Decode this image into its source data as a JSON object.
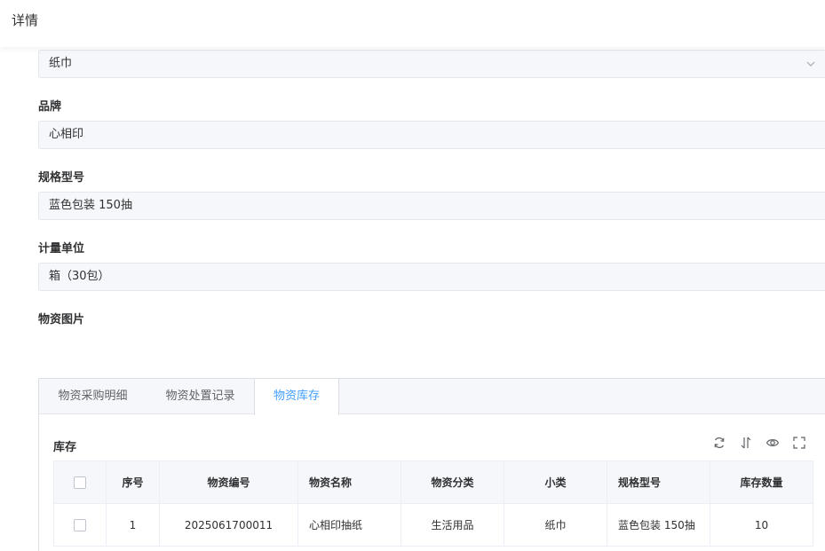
{
  "header": {
    "title": "详情"
  },
  "form": {
    "category_value": "纸巾",
    "brand_label": "品牌",
    "brand_value": "心相印",
    "spec_label": "规格型号",
    "spec_value": "蓝色包装 150抽",
    "unit_label": "计量单位",
    "unit_value": "箱（30包）",
    "image_label": "物资图片"
  },
  "tabs": [
    {
      "label": "物资采购明细",
      "active": false
    },
    {
      "label": "物资处置记录",
      "active": false
    },
    {
      "label": "物资库存",
      "active": true
    }
  ],
  "stock": {
    "title": "库存",
    "toolbar_icons": [
      "refresh-icon",
      "column-height-icon",
      "eye-icon",
      "fullscreen-icon"
    ],
    "columns": [
      "序号",
      "物资编号",
      "物资名称",
      "物资分类",
      "小类",
      "规格型号",
      "库存数量"
    ],
    "rows": [
      {
        "index": "1",
        "code": "2025061700011",
        "name": "心相印抽纸",
        "category": "生活用品",
        "subcategory": "纸巾",
        "spec": "蓝色包装 150抽",
        "qty": "10"
      }
    ]
  },
  "colors": {
    "accent": "#409eff",
    "input_bg": "#f5f7fa",
    "border": "#dcdfe6"
  }
}
